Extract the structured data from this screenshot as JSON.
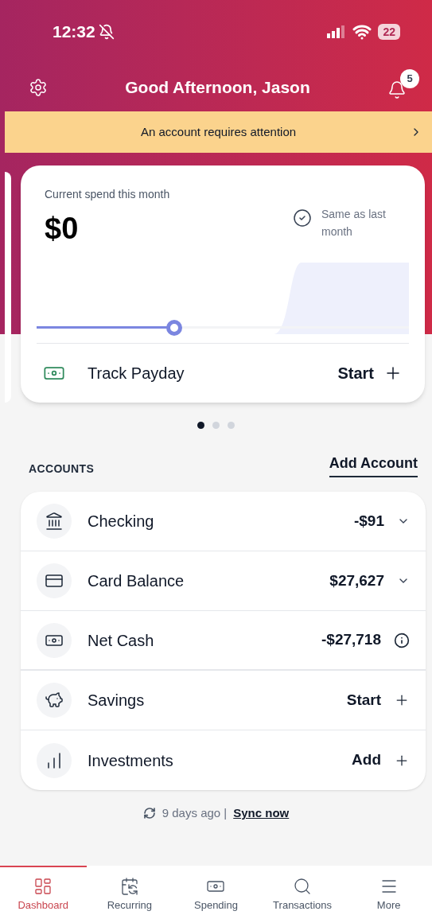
{
  "status_bar": {
    "time": "12:32",
    "battery": "22"
  },
  "header": {
    "greeting": "Good Afternoon, Jason",
    "notifications": "5"
  },
  "alert": {
    "text": "An account requires attention"
  },
  "spend_card": {
    "label": "Current spend this month",
    "amount": "$0",
    "comparison": "Same as last month",
    "level": 0.37,
    "action": {
      "label": "Track Payday",
      "button": "Start"
    }
  },
  "carousel": [
    {
      "selected": true
    },
    {
      "selected": false
    },
    {
      "selected": false
    }
  ],
  "accounts": {
    "title": "ACCOUNTS",
    "add": "Add Account",
    "rows": [
      {
        "kind": "expandable",
        "name": "Checking",
        "value": "-$91",
        "expanded": false
      },
      {
        "kind": "expandable",
        "name": "Card Balance",
        "value": "$27,627",
        "expanded": false
      },
      {
        "kind": "info",
        "name": "Net Cash",
        "value": "-$27,718"
      },
      {
        "kind": "action",
        "name": "Savings",
        "value": "Start"
      },
      {
        "kind": "action",
        "name": "Investments",
        "value": "Add"
      }
    ]
  },
  "sync": {
    "text": "9 days ago |",
    "link": "Sync now"
  },
  "tabs": [
    {
      "label": "Dashboard",
      "selected": true
    },
    {
      "label": "Recurring",
      "selected": false
    },
    {
      "label": "Spending",
      "selected": false
    },
    {
      "label": "Transactions",
      "selected": false
    },
    {
      "label": "More",
      "selected": false
    }
  ]
}
